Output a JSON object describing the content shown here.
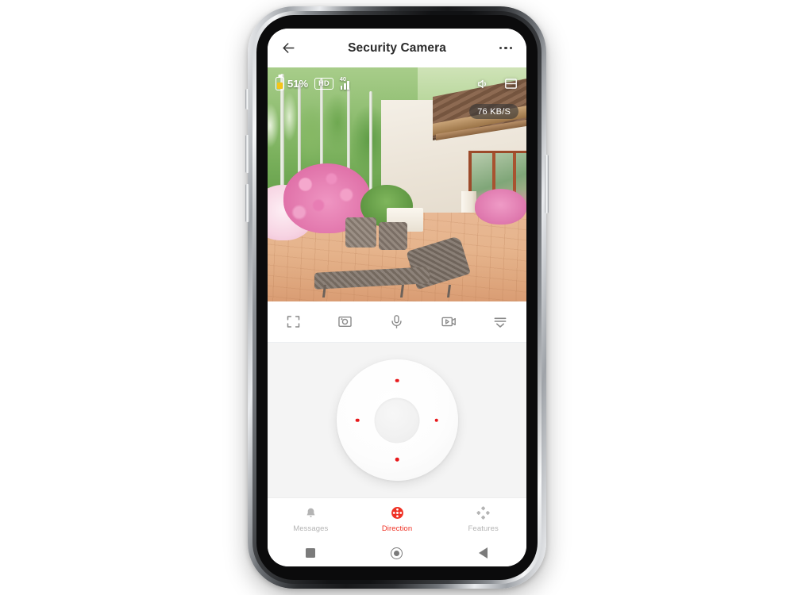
{
  "app": {
    "header": {
      "title": "Security Camera",
      "back_icon": "arrow-left-icon",
      "more_icon": "more-horizontal-icon"
    }
  },
  "video": {
    "status": {
      "battery_icon": "battery-icon",
      "battery_percent": "51%",
      "battery_fill_color": "#f5c518",
      "quality_badge": "HD",
      "signal_icon": "signal-bars-icon",
      "signal_value": "40"
    },
    "controls": {
      "volume_icon": "speaker-icon",
      "layout_icon": "split-view-icon"
    },
    "bitrate": "76 KB/S",
    "scene_description": "Patio with wicker lounger, pink rhododendron bushes and house glass doors"
  },
  "toolbar": {
    "items": [
      {
        "name": "fullscreen",
        "icon": "fullscreen-icon"
      },
      {
        "name": "screenshot",
        "icon": "camera-icon"
      },
      {
        "name": "talk",
        "icon": "microphone-icon"
      },
      {
        "name": "record",
        "icon": "video-record-icon"
      },
      {
        "name": "more",
        "icon": "more-options-icon"
      }
    ]
  },
  "dpad": {
    "label": "direction-pad",
    "dot_color": "#e8191c",
    "directions": [
      "up",
      "right",
      "down",
      "left"
    ]
  },
  "tabs": [
    {
      "label": "Messages",
      "icon": "bell-icon",
      "active": false
    },
    {
      "label": "Direction",
      "icon": "direction-icon",
      "active": true
    },
    {
      "label": "Features",
      "icon": "diamonds-icon",
      "active": false
    }
  ],
  "theme": {
    "accent": "#ef3124",
    "dpad_dot": "#e8191c",
    "inactive": "#b4b4b4",
    "panel_bg": "#f4f4f4"
  },
  "android_nav": [
    {
      "name": "recents",
      "icon": "square-icon"
    },
    {
      "name": "home",
      "icon": "home-circle-icon"
    },
    {
      "name": "back",
      "icon": "triangle-back-icon"
    }
  ]
}
